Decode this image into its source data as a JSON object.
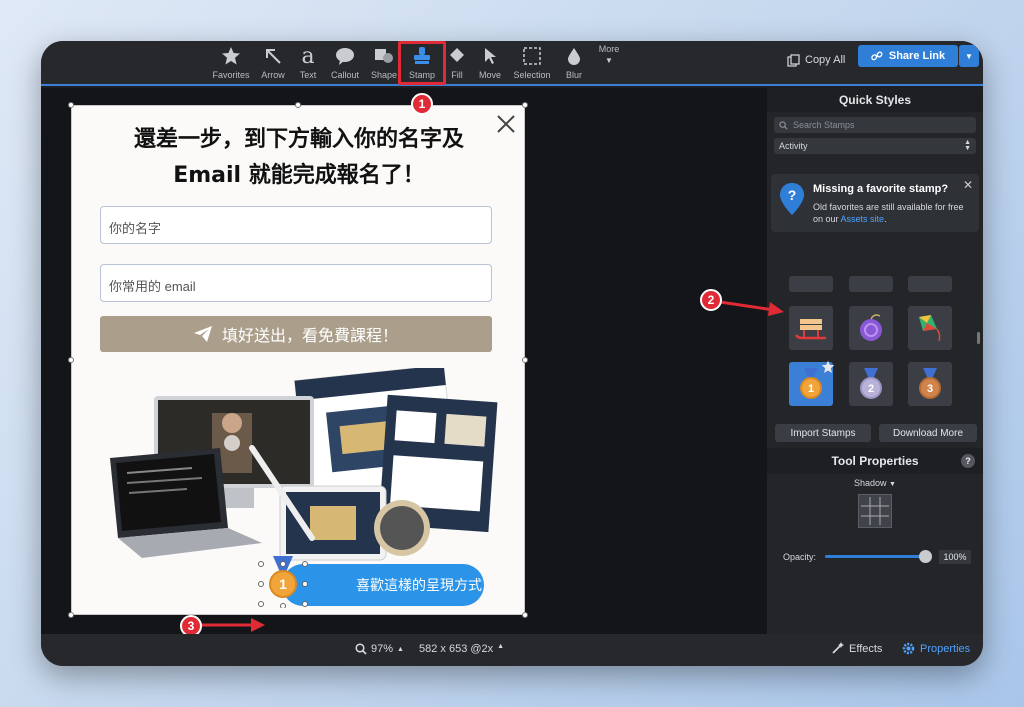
{
  "toolbar": {
    "tools": [
      {
        "label": "Favorites",
        "icon": "star-icon"
      },
      {
        "label": "Arrow",
        "icon": "arrow-icon"
      },
      {
        "label": "Text",
        "icon": "text-icon"
      },
      {
        "label": "Callout",
        "icon": "callout-icon"
      },
      {
        "label": "Shape",
        "icon": "shape-icon"
      },
      {
        "label": "Stamp",
        "icon": "stamp-icon"
      },
      {
        "label": "Fill",
        "icon": "fill-icon"
      },
      {
        "label": "Move",
        "icon": "move-icon"
      },
      {
        "label": "Selection",
        "icon": "selection-icon"
      },
      {
        "label": "Blur",
        "icon": "blur-icon"
      },
      {
        "label": "More",
        "icon": "chevron-down-icon"
      }
    ],
    "copy_all": "Copy All",
    "share_link": "Share Link"
  },
  "callouts": {
    "one": "1",
    "two": "2",
    "three": "3"
  },
  "popup": {
    "title_line1": "還差一步，到下方輸入你的名字及",
    "title_line2": "Email 就能完成報名了！",
    "name_placeholder": "你的名字",
    "email_placeholder": "你常用的 email",
    "submit_label": "填好送出，看免費課程！",
    "like_button": "喜歡這樣的呈現方式",
    "medal_number": "1"
  },
  "status": {
    "zoom": "97%",
    "size": "582 x 653 @2x",
    "effects": "Effects",
    "properties": "Properties"
  },
  "panel": {
    "quick_styles": "Quick Styles",
    "search_placeholder": "Search Stamps",
    "category": "Activity",
    "tip_title": "Missing a favorite stamp?",
    "tip_body": "Old favorites are still available for free on our",
    "tip_link": "Assets site",
    "tip_end": ".",
    "import_stamps": "Import Stamps",
    "download_more": "Download More",
    "tool_properties": "Tool Properties",
    "help": "?",
    "shadow": "Shadow",
    "opacity_label": "Opacity:",
    "opacity_value": "100%",
    "opacity_fraction": 1.0,
    "medal_labels": [
      "1",
      "2",
      "3"
    ]
  },
  "colors": {
    "accent": "#2f7fd9",
    "highlight_red": "#e02a36",
    "medal_gold": "#f0a43a",
    "medal_silver": "#b8b2d8",
    "medal_bronze": "#d0834a"
  }
}
